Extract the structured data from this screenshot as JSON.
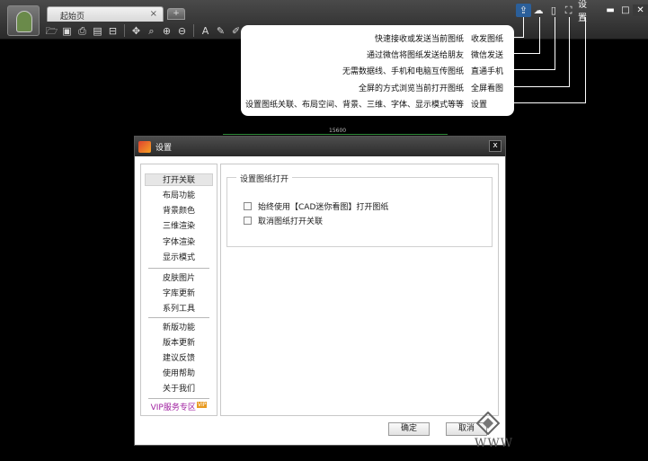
{
  "tab": {
    "label": "起始页",
    "close": "×",
    "new": "+"
  },
  "top_right": {
    "settings_label": "设置",
    "minimize": "▬",
    "maximize": "□",
    "close": "✕"
  },
  "tooltips": [
    {
      "desc": "快速接收或发送当前图纸",
      "name": "收发图纸"
    },
    {
      "desc": "通过微信将图纸发送给朋友",
      "name": "微信发送"
    },
    {
      "desc": "无需数据线、手机和电脑互传图纸",
      "name": "直通手机"
    },
    {
      "desc": "全屏的方式浏览当前打开图纸",
      "name": "全屏看图"
    },
    {
      "desc": "设置图纸关联、布局空间、背景、三维、字体、显示模式等等",
      "name": "设置"
    }
  ],
  "canvas": {
    "dimension": "15600"
  },
  "dialog": {
    "title": "设置",
    "close": "x",
    "sidebar": [
      "打开关联",
      "布局功能",
      "背景颜色",
      "三维渲染",
      "字体渲染",
      "显示模式",
      "皮肤图片",
      "字库更新",
      "系列工具",
      "新版功能",
      "版本更新",
      "建议反馈",
      "使用帮助",
      "关于我们"
    ],
    "vip_label": "VIP服务专区",
    "vip_badge": "VIP",
    "group_title": "设置图纸打开",
    "options": [
      "始终使用【CAD迷你看图】打开图纸",
      "取消图纸打开关联"
    ],
    "ok_label": "确定",
    "cancel_label": "取消"
  },
  "watermark": {
    "text": "WWW"
  },
  "colors": {
    "accent": "#2b5f9a",
    "vip": "#a020a0",
    "canvas_line": "#2f8a3a"
  }
}
